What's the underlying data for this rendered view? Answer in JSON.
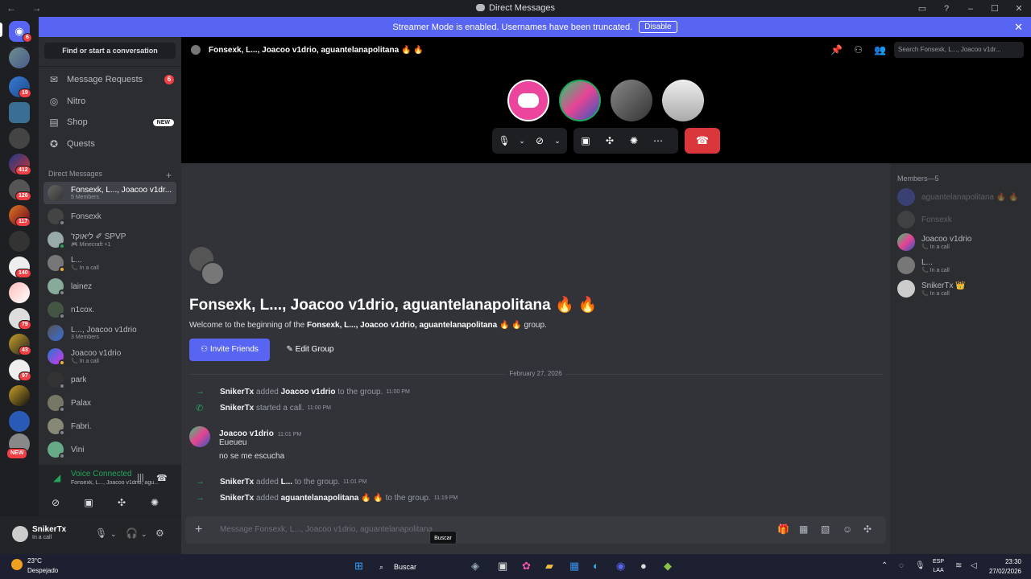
{
  "window": {
    "title": "Direct Messages",
    "nav": "← →"
  },
  "banner": {
    "text": "Streamer Mode is enabled. Usernames have been truncated.",
    "button": "Disable"
  },
  "guilds": {
    "badges": [
      "6",
      "19",
      "412",
      "126",
      "117",
      "140",
      "79",
      "43",
      "97"
    ],
    "new_label": "NEW"
  },
  "sidebar": {
    "search": "Find or start a conversation",
    "nav": [
      {
        "label": "Message Requests",
        "badge": "6"
      },
      {
        "label": "Nitro"
      },
      {
        "label": "Shop",
        "badge": "NEW"
      },
      {
        "label": "Quests"
      }
    ],
    "dm_header": "Direct Messages",
    "dms": [
      {
        "name": "Fonsexk, L..., Joacoo v1dr...",
        "sub": "5 Members"
      },
      {
        "name": "Fonsexk",
        "sub": ""
      },
      {
        "name": "'ליאוקז  ✐ SPVP",
        "sub": "🎮 Minecraft +1"
      },
      {
        "name": "L...",
        "sub": "📞 In a call"
      },
      {
        "name": "lainez",
        "sub": ""
      },
      {
        "name": "n1cox.",
        "sub": ""
      },
      {
        "name": "L..., Joacoo v1drio",
        "sub": "3 Members"
      },
      {
        "name": "Joacoo v1drio",
        "sub": "📞 In a call"
      },
      {
        "name": "park",
        "sub": ""
      },
      {
        "name": "Palax",
        "sub": ""
      },
      {
        "name": "Fabri.",
        "sub": ""
      },
      {
        "name": "Vini",
        "sub": ""
      }
    ]
  },
  "voice": {
    "status": "Voice Connected",
    "channel": "Fonsexk, L..., Joacoo v1drio, agu..."
  },
  "user": {
    "name": "SnikerTx",
    "status": "In a call"
  },
  "call": {
    "header": "Fonsexk, L..., Joacoo v1drio, aguantelanapolitana 🔥 🔥",
    "search_placeholder": "Search Fonsexk, L..., Joacoo v1dr..."
  },
  "chat": {
    "title": "Fonsexk, L..., Joacoo v1drio, aguantelanapolitana 🔥 🔥",
    "welcome_prefix": "Welcome to the beginning of the",
    "welcome_group": "Fonsexk, L..., Joacoo v1drio, aguantelanapolitana 🔥 🔥",
    "welcome_suffix": "group.",
    "invite": "Invite Friends",
    "edit": "Edit Group",
    "date": "February 27, 2026",
    "sys1": {
      "actor": "SnikerTx",
      "verb": "added",
      "target": "Joacoo v1drio",
      "rest": "to the group.",
      "time": "11:00 PM"
    },
    "sys2": {
      "actor": "SnikerTx",
      "verb": "started a call.",
      "time": "11:00 PM"
    },
    "msg": {
      "author": "Joacoo v1drio",
      "time": "11:01 PM",
      "line1": "Eueueu",
      "line2": "no se me escucha"
    },
    "sys3": {
      "actor": "SnikerTx",
      "verb": "added",
      "target": "L...",
      "rest": "to the group.",
      "time": "11:01 PM"
    },
    "sys4": {
      "actor": "SnikerTx",
      "verb": "added",
      "target": "aguantelanapolitana 🔥 🔥",
      "rest": "to the group.",
      "time": "11:19 PM"
    },
    "composer_placeholder": "Message Fonsexk, L..., Joacoo v1drio, aguantelanapolitana"
  },
  "members": {
    "header": "Members—5",
    "list": [
      {
        "name": "aguantelanapolitana 🔥 🔥",
        "sub": ""
      },
      {
        "name": "Fonsexk",
        "sub": ""
      },
      {
        "name": "Joacoo v1drio",
        "sub": "📞 In a call"
      },
      {
        "name": "L...",
        "sub": "📞 In a call"
      },
      {
        "name": "SnikerTx 👑",
        "sub": "📞 In a call"
      }
    ]
  },
  "tooltip": "Buscar",
  "taskbar": {
    "temp": "23°C",
    "condition": "Despejado",
    "search": "Buscar",
    "lang1": "ESP",
    "lang2": "LAA",
    "time": "23:30",
    "date": "27/02/2026"
  },
  "colors": {
    "blurple": "#5865f2",
    "green": "#23a55a",
    "red": "#da373c"
  }
}
